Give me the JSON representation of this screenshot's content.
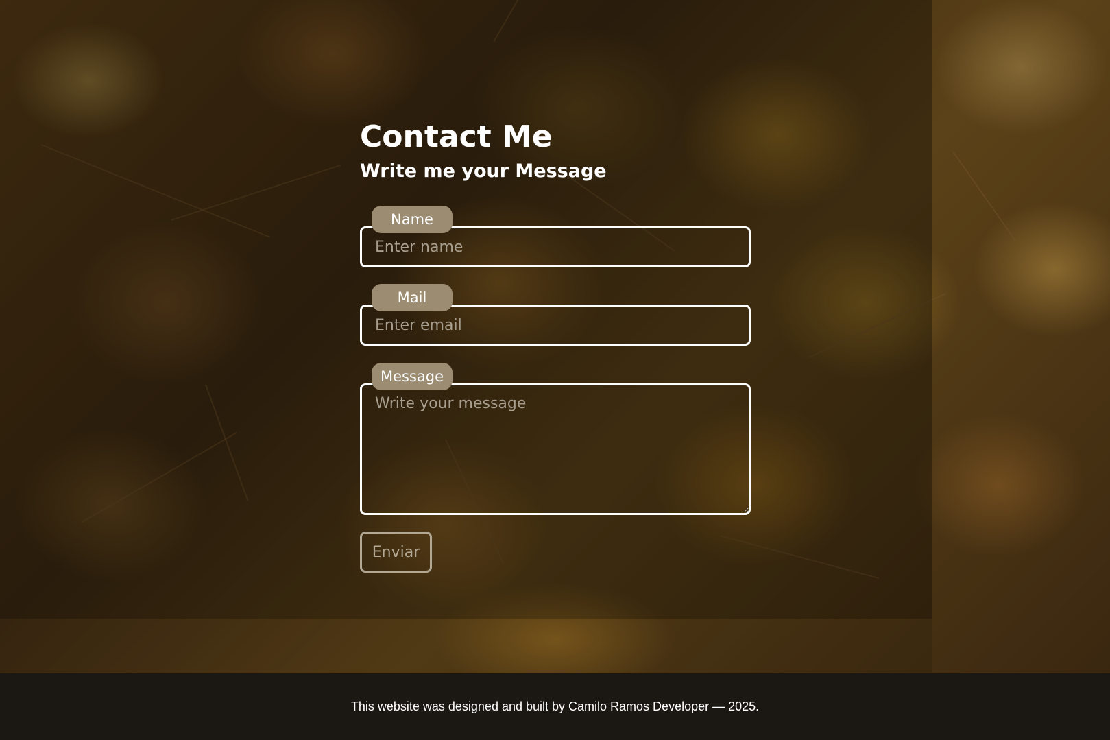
{
  "contact": {
    "title": "Contact Me",
    "subtitle": "Write me your Message"
  },
  "form": {
    "name": {
      "label": "Name",
      "placeholder": "Enter name"
    },
    "mail": {
      "label": "Mail",
      "placeholder": "Enter email"
    },
    "message": {
      "label": "Message",
      "placeholder": "Write your message"
    },
    "submit_label": "Enviar"
  },
  "footer": {
    "text": "This website was designed and built by Camilo Ramos Developer — 2025."
  },
  "colors": {
    "label_background": "#9c8c72",
    "footer_background": "#1b1712",
    "field_border": "#ffffff",
    "submit_border": "#b3a893"
  }
}
